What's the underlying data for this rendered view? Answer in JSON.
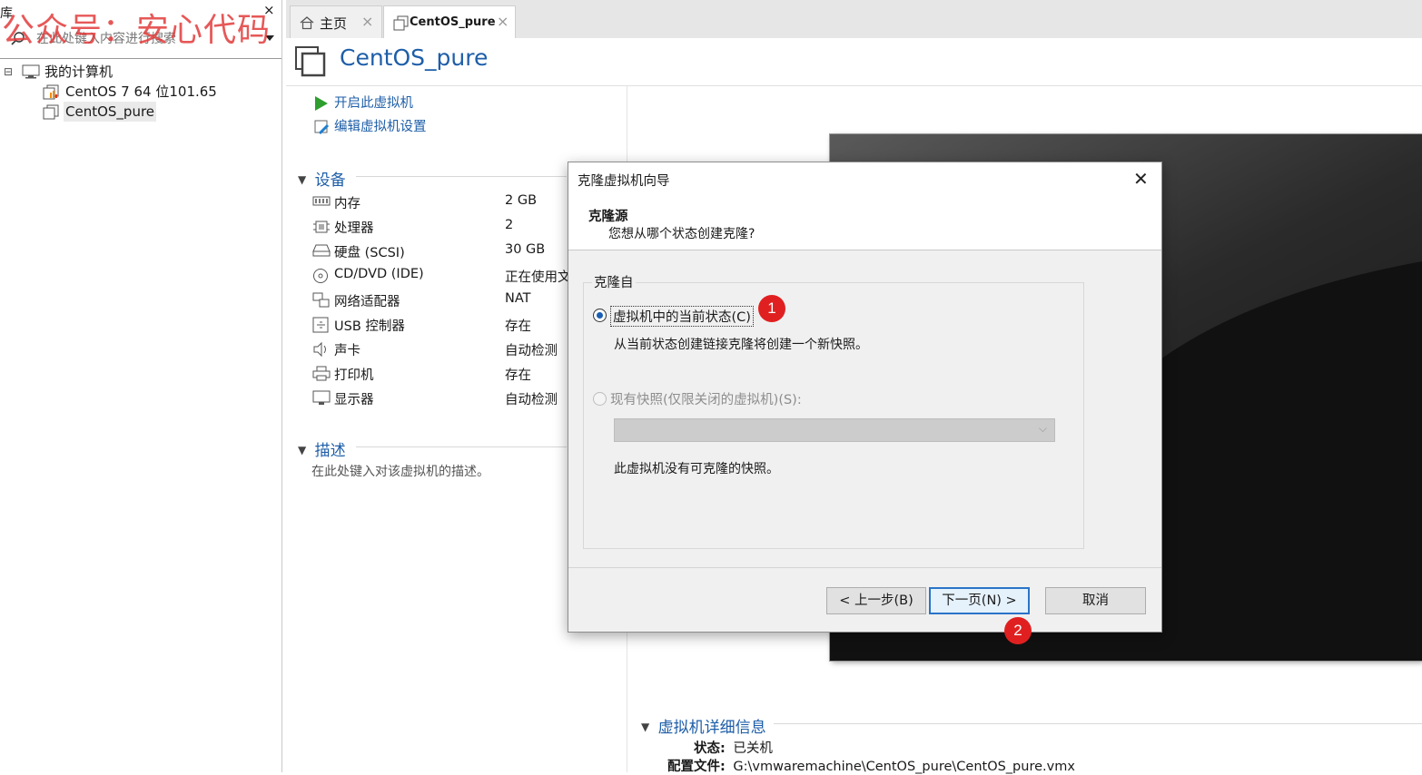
{
  "watermark": "公众号：安心代码",
  "library": {
    "title": "库",
    "close": "×",
    "search_placeholder": "在此处键入内容进行搜索",
    "tree": [
      {
        "label": "我的计算机",
        "toggle": "⊟",
        "icon": "computer-icon"
      },
      {
        "label": "CentOS 7 64 位101.65",
        "icon": "vm-running-icon"
      },
      {
        "label": "CentOS_pure",
        "icon": "vm-icon",
        "selected": true
      }
    ]
  },
  "tabs": [
    {
      "label": "主页",
      "icon": "home-icon",
      "close": "×"
    },
    {
      "label": "CentOS_pure",
      "icon": "vm-icon",
      "close": "×",
      "active": true
    }
  ],
  "vm": {
    "title": "CentOS_pure",
    "actions": {
      "power_on": "开启此虚拟机",
      "edit_settings": "编辑虚拟机设置"
    },
    "devices_title": "设备",
    "devices": [
      {
        "name": "内存",
        "value": "2 GB",
        "icon": "memory-icon"
      },
      {
        "name": "处理器",
        "value": "2",
        "icon": "cpu-icon"
      },
      {
        "name": "硬盘 (SCSI)",
        "value": "30 GB",
        "icon": "harddisk-icon"
      },
      {
        "name": "CD/DVD (IDE)",
        "value": "正在使用文",
        "icon": "cdrom-icon"
      },
      {
        "name": "网络适配器",
        "value": "NAT",
        "icon": "network-icon"
      },
      {
        "name": "USB 控制器",
        "value": "存在",
        "icon": "usb-icon"
      },
      {
        "name": "声卡",
        "value": "自动检测",
        "icon": "sound-icon"
      },
      {
        "name": "打印机",
        "value": "存在",
        "icon": "printer-icon"
      },
      {
        "name": "显示器",
        "value": "自动检测",
        "icon": "display-icon"
      }
    ],
    "description_title": "描述",
    "description_placeholder": "在此处键入对该虚拟机的描述。",
    "details_title": "虚拟机详细信息",
    "details": {
      "status_label": "状态:",
      "status_value": "已关机",
      "config_label": "配置文件:",
      "config_value": "G:\\vmwaremachine\\CentOS_pure\\CentOS_pure.vmx"
    }
  },
  "dialog": {
    "title": "克隆虚拟机向导",
    "close": "✕",
    "heading": "克隆源",
    "subheading": "您想从哪个状态创建克隆?",
    "group_label": "克隆自",
    "option_current": {
      "label": "虚拟机中的当前状态(C)",
      "selected": true,
      "description": "从当前状态创建链接克隆将创建一个新快照。"
    },
    "option_snapshot": {
      "label": "现有快照(仅限关闭的虚拟机)(S):",
      "selected": false,
      "disabled": true
    },
    "snapshot_select_value": "",
    "no_snapshot_text": "此虚拟机没有可克隆的快照。",
    "buttons": {
      "back": "< 上一步(B)",
      "next": "下一页(N) >",
      "cancel": "取消"
    }
  },
  "annotations": [
    "1",
    "2"
  ],
  "colors": {
    "accent": "#1e5ea8",
    "badge": "#e02020",
    "play": "#2e9e2e"
  }
}
